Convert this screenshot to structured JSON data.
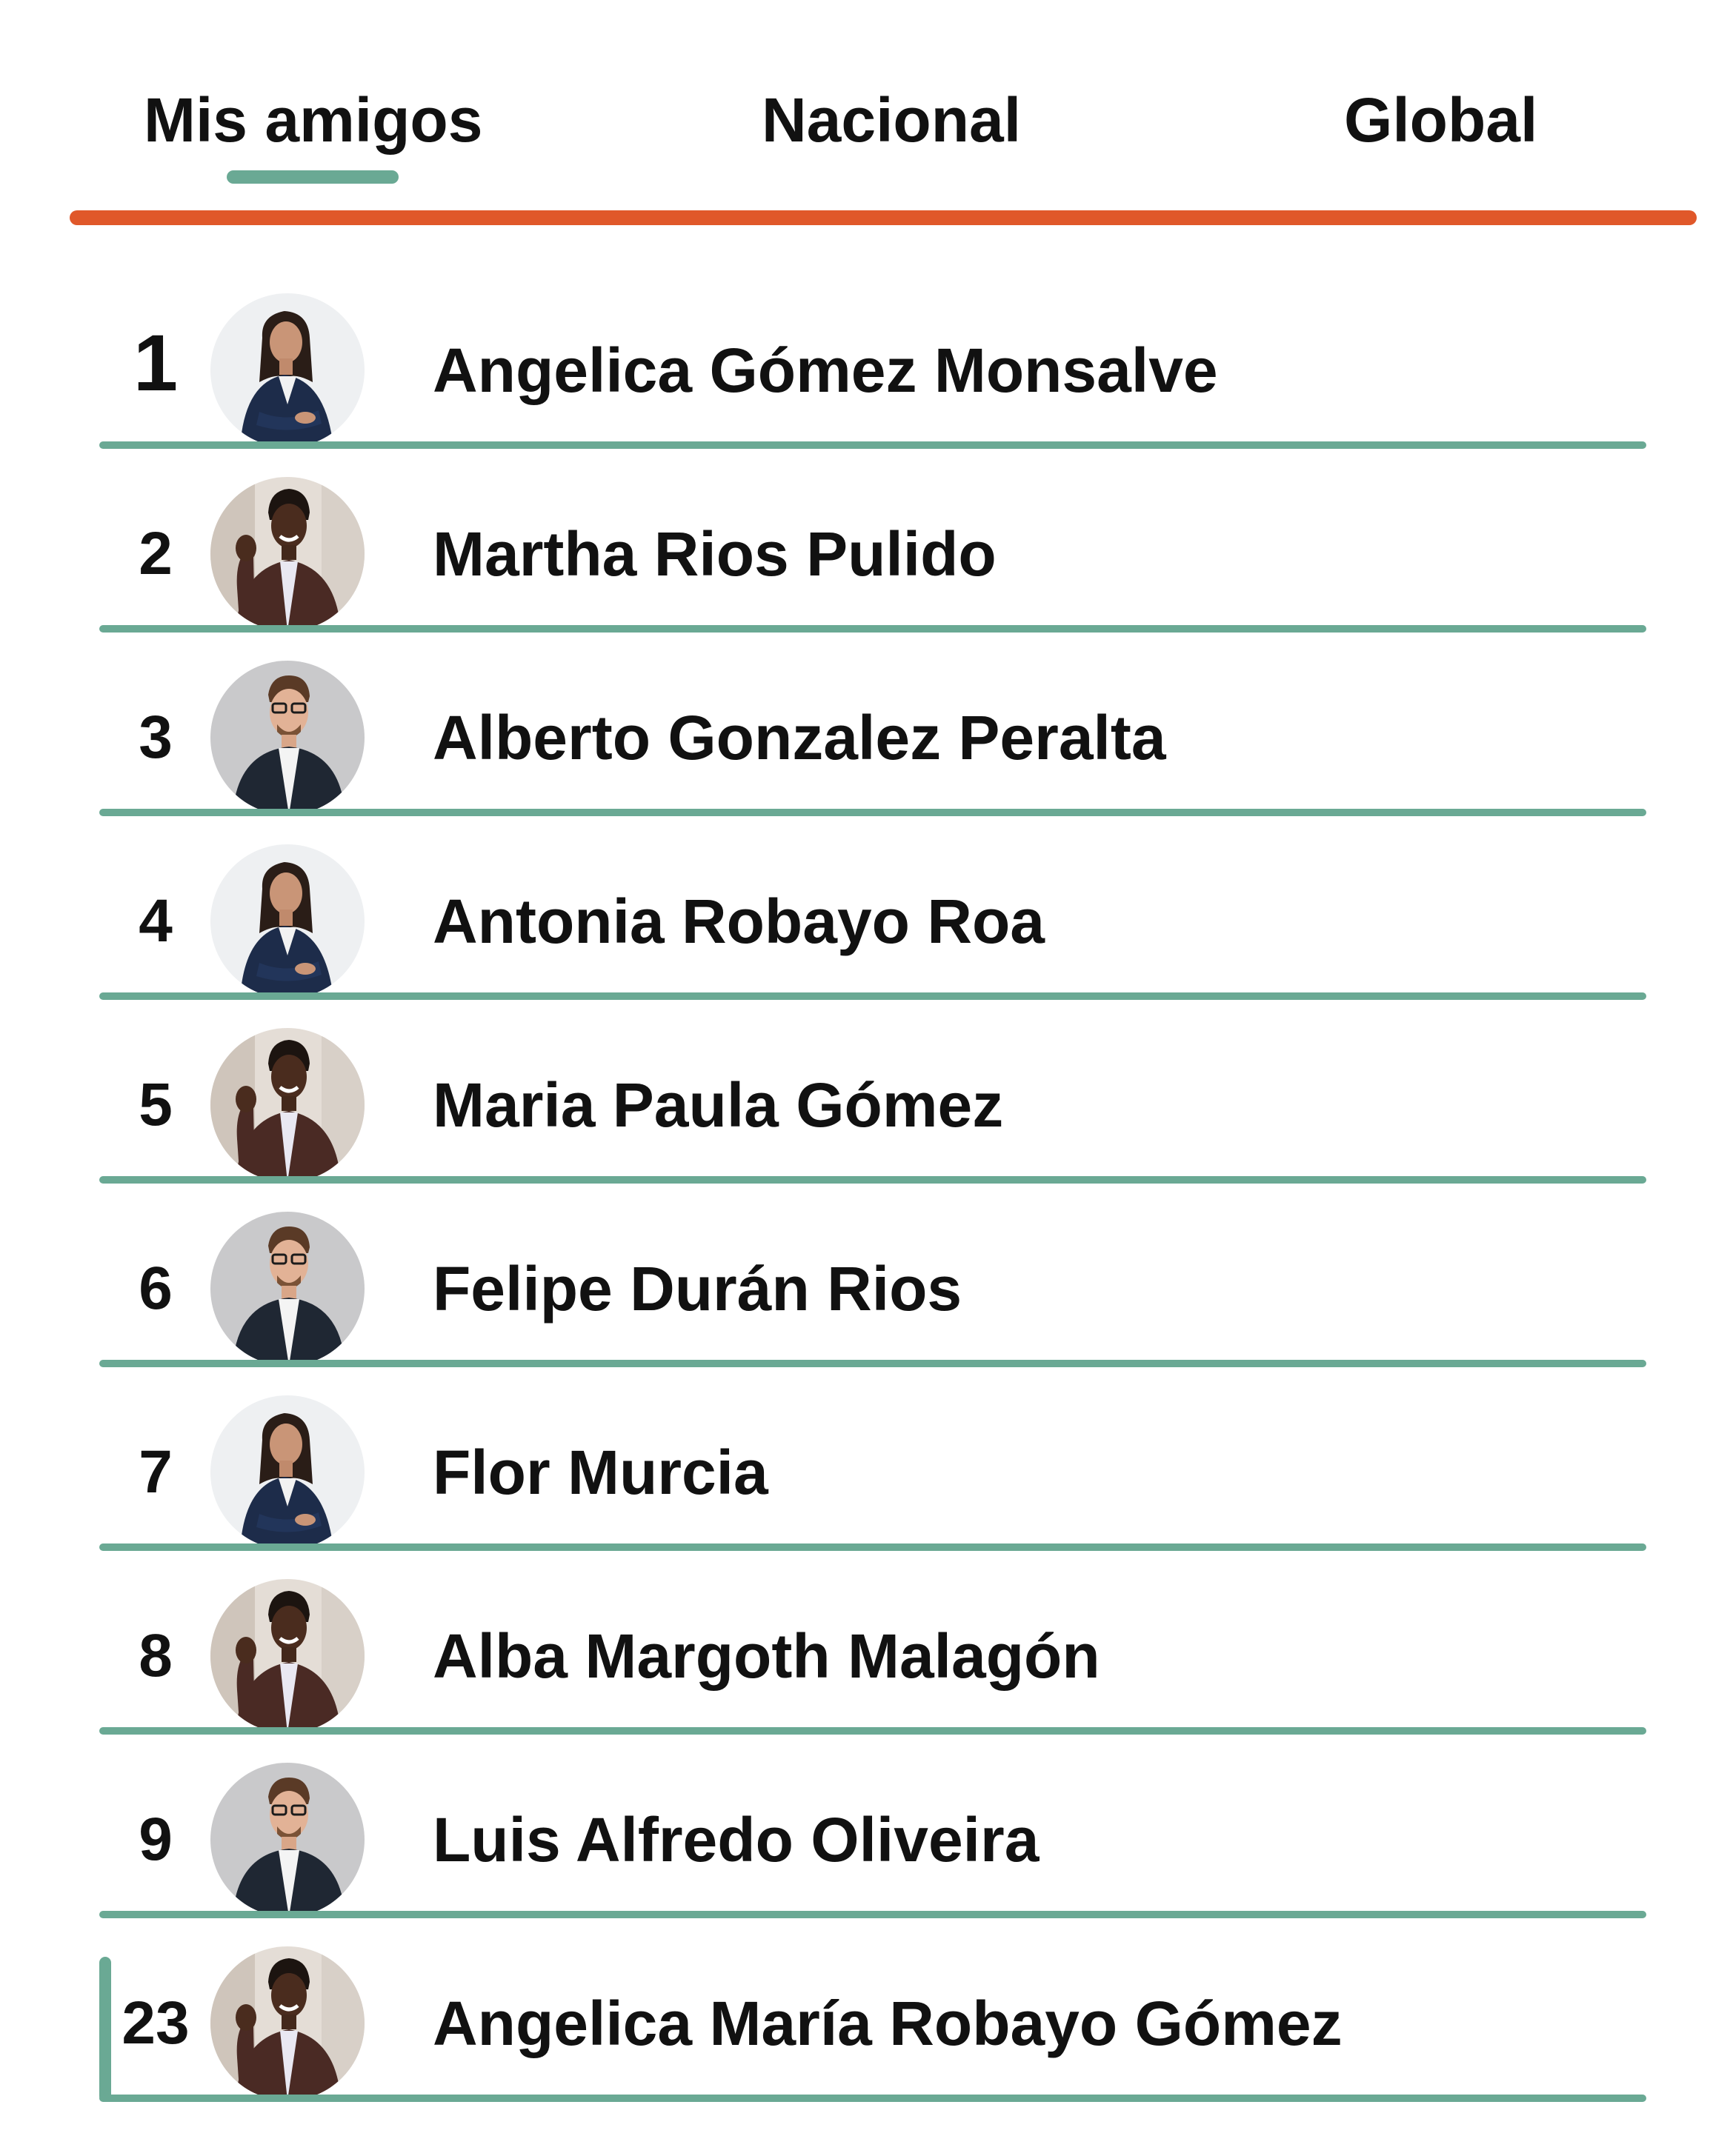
{
  "colors": {
    "accent_green": "#6aa994",
    "accent_orange": "#e0582a",
    "text": "#111111"
  },
  "tabs": [
    {
      "label": "Mis amigos",
      "active": true
    },
    {
      "label": "Nacional",
      "active": false
    },
    {
      "label": "Global",
      "active": false
    }
  ],
  "leaderboard": [
    {
      "rank": "1",
      "name": "Angelica Gómez Monsalve",
      "avatar": "woman-blazer-avatar"
    },
    {
      "rank": "2",
      "name": "Martha Rios Pulido",
      "avatar": "woman-waving-avatar"
    },
    {
      "rank": "3",
      "name": "Alberto Gonzalez Peralta",
      "avatar": "man-glasses-avatar"
    },
    {
      "rank": "4",
      "name": "Antonia Robayo Roa",
      "avatar": "woman-blazer-avatar"
    },
    {
      "rank": "5",
      "name": "Maria Paula Gómez",
      "avatar": "woman-waving-avatar"
    },
    {
      "rank": "6",
      "name": "Felipe Durán Rios",
      "avatar": "man-glasses-avatar"
    },
    {
      "rank": "7",
      "name": "Flor Murcia",
      "avatar": "woman-blazer-avatar"
    },
    {
      "rank": "8",
      "name": "Alba Margoth Malagón",
      "avatar": "woman-waving-avatar"
    },
    {
      "rank": "9",
      "name": "Luis Alfredo Oliveira",
      "avatar": "man-glasses-avatar"
    },
    {
      "rank": "23",
      "name": "Angelica María Robayo Gómez",
      "avatar": "woman-waving-avatar",
      "current_user": true
    }
  ]
}
